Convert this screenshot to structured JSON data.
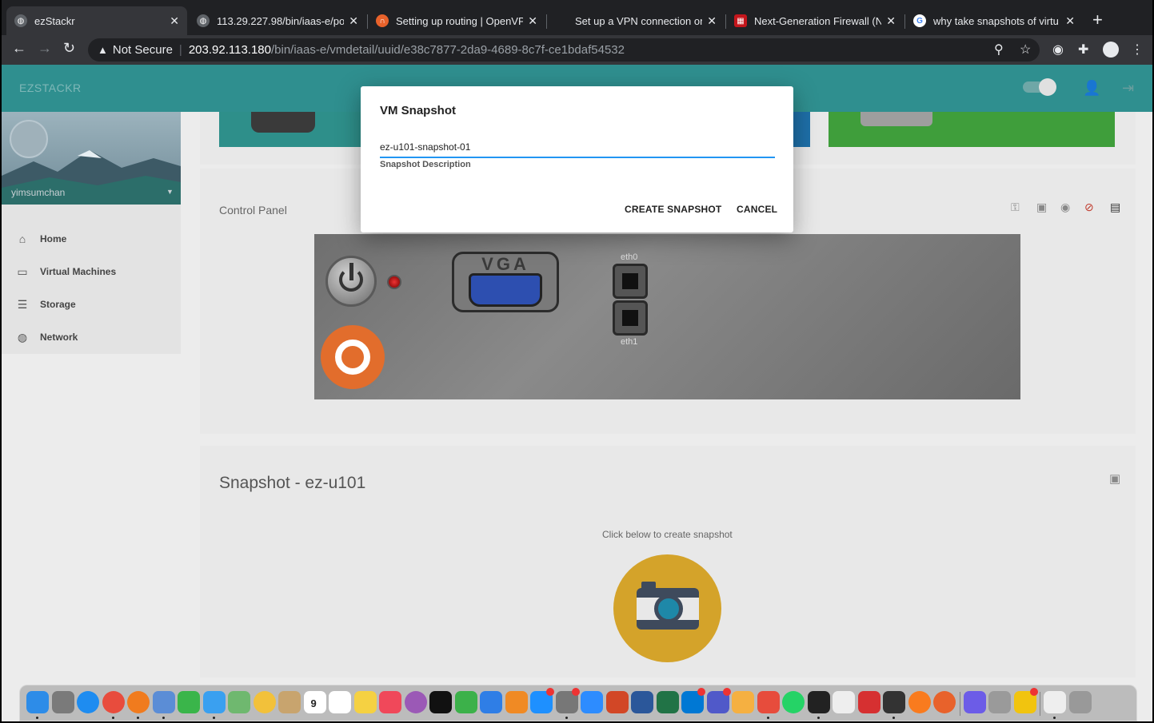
{
  "browser": {
    "tabs": [
      {
        "title": "ezStackr",
        "active": true,
        "icon": "globe-icon"
      },
      {
        "title": "113.29.227.98/bin/iaas-e/po",
        "icon": "globe-icon"
      },
      {
        "title": "Setting up routing | OpenVP",
        "icon": "openvpn-icon"
      },
      {
        "title": "Set up a VPN connection on",
        "icon": "apple-icon"
      },
      {
        "title": "Next-Generation Firewall (N",
        "icon": "firewall-icon"
      },
      {
        "title": "why take snapshots of virtu",
        "icon": "google-icon"
      }
    ],
    "new_tab": "+",
    "security_label": "Not Secure",
    "url_host": "203.92.113.180",
    "url_path": "/bin/iaas-e/vmdetail/uuid/e38c7877-2da9-4689-8c7f-ce1bdaf54532"
  },
  "app": {
    "brand": "EZSTACKR",
    "user": {
      "name": "yimsumchan"
    },
    "nav": [
      {
        "label": "Home",
        "icon": "home-icon"
      },
      {
        "label": "Virtual Machines",
        "icon": "devices-icon"
      },
      {
        "label": "Storage",
        "icon": "storage-icon"
      },
      {
        "label": "Network",
        "icon": "globe-icon"
      }
    ],
    "control_panel": {
      "title": "Control Panel",
      "actions": [
        "key-icon",
        "camera-icon",
        "record-icon",
        "no-entry-icon",
        "console-icon"
      ],
      "vga_label": "VGA",
      "eth0": "eth0",
      "eth1": "eth1"
    },
    "snapshot": {
      "title": "Snapshot - ez-u101",
      "hint": "Click below to create snapshot"
    }
  },
  "modal": {
    "title": "VM Snapshot",
    "description_value": "ez-u101-snapshot-01",
    "description_label": "Snapshot Description",
    "create_label": "CREATE SNAPSHOT",
    "cancel_label": "CANCEL"
  },
  "colors": {
    "appbar": "#2f8f8f",
    "input_underline": "#2196f3",
    "snapshot_button": "#d4a32a",
    "ubuntu": "#e26d2c"
  },
  "dock": {
    "apps": [
      "finder-icon",
      "launchpad-icon",
      "safari-icon",
      "chrome-icon",
      "firefox-icon",
      "preview-icon",
      "facetime-icon",
      "messages-icon",
      "maps-icon",
      "photos-icon",
      "contacts-icon",
      "calendar-icon",
      "reminders-icon",
      "notes-icon",
      "music-icon",
      "podcasts-icon",
      "tv-icon",
      "numbers-icon",
      "keynote-icon",
      "pages-icon",
      "appstore-icon",
      "systemprefs-icon",
      "zoom-icon",
      "powerpoint-icon",
      "word-icon",
      "excel-icon",
      "outlook-icon",
      "teams-icon",
      "paint-icon",
      "parallels-icon",
      "whatsapp-icon",
      "terminal-icon",
      "textedit-icon",
      "shield-icon",
      "activity-icon",
      "firefox-dev-icon",
      "openvpn-icon",
      "imovie-icon",
      "photo-booth-icon",
      "ms-store-icon",
      "downloads-icon",
      "trash-icon"
    ],
    "calendar_day": "9",
    "badges": {
      "appstore": "6",
      "systemprefs": "1",
      "outlook": "316",
      "teams": "2",
      "ms-store": "5"
    }
  }
}
